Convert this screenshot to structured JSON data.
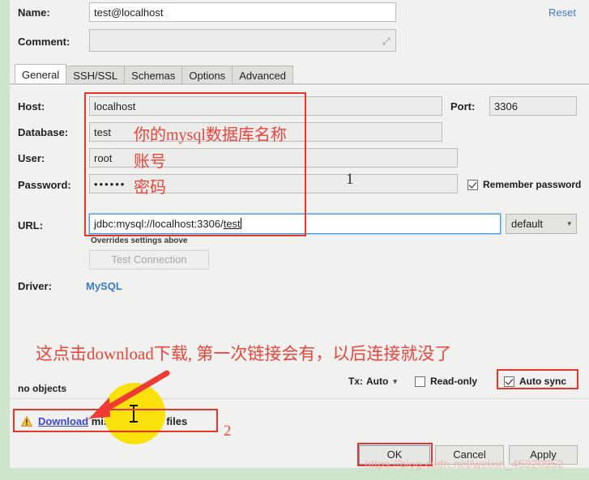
{
  "window": {
    "background_color": "#f1f1ef",
    "accent_color": "#e8352a",
    "link_color": "#3a7bc8"
  },
  "header": {
    "name_label": "Name:",
    "name_value": "test@localhost",
    "comment_label": "Comment:",
    "comment_value": "",
    "comment_expand_icon": "expand-icon",
    "reset_label": "Reset"
  },
  "tabs": [
    {
      "label": "General",
      "active": true
    },
    {
      "label": "SSH/SSL",
      "active": false
    },
    {
      "label": "Schemas",
      "active": false
    },
    {
      "label": "Options",
      "active": false
    },
    {
      "label": "Advanced",
      "active": false
    }
  ],
  "general": {
    "host_label": "Host:",
    "host_value": "localhost",
    "port_label": "Port:",
    "port_value": "3306",
    "database_label": "Database:",
    "database_value": "test",
    "user_label": "User:",
    "user_value": "root",
    "password_label": "Password:",
    "password_value": "••••••",
    "remember_password_label": "Remember password",
    "remember_password_checked": true,
    "url_label": "URL:",
    "url_value_plain": "jdbc:mysql://localhost:3306/",
    "url_value_underlined": "test",
    "url_dropdown_value": "default",
    "url_dropdown_icon": "chevron-down-icon",
    "overrides_note": "Overrides settings above",
    "test_connection_label": "Test Connection",
    "test_connection_enabled": false,
    "driver_label": "Driver:",
    "driver_value": "MySQL"
  },
  "status_bar": {
    "objects_text": "no objects",
    "tx_label": "Tx:",
    "tx_value": "Auto",
    "tx_dropdown_icon": "chevron-down-icon",
    "readonly_label": "Read-only",
    "readonly_checked": false,
    "autosync_label": "Auto sync",
    "autosync_checked": true
  },
  "driver_warning": {
    "icon": "warning-triangle-icon",
    "link_text": "Download",
    "rest_text": " missing driver files"
  },
  "footer_buttons": [
    {
      "label": "OK",
      "default": true
    },
    {
      "label": "Cancel",
      "default": false
    },
    {
      "label": "Apply",
      "default": false
    }
  ],
  "annotations": {
    "database_note": "你的mysql数据库名称",
    "user_note": "账号",
    "password_note": "密码",
    "marker_one": "1",
    "marker_two": "2",
    "download_note": "这点击download下载, 第一次链接会有，以后连接就没了"
  },
  "watermark": "https://blog.csdn.net/weixin_45920952"
}
